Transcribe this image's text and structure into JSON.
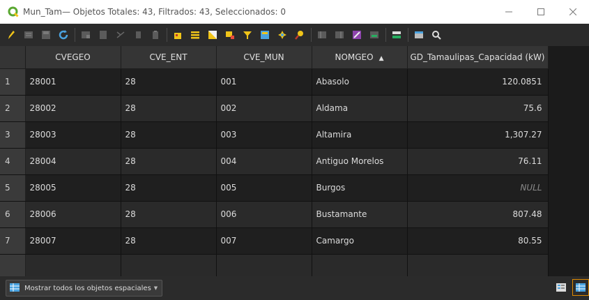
{
  "window": {
    "title": "Mun_Tam— Objetos Totales: 43, Filtrados: 43, Seleccionados: 0"
  },
  "colors": {
    "qgis_green": "#5aa832",
    "highlight_orange": "#e08a00"
  },
  "toolbar": {
    "icons": [
      "pencil-icon",
      "multi-edit-icon",
      "save-edits-icon",
      "reload-icon",
      "add-feature-icon",
      "delete-feature-icon",
      "cut-icon",
      "copy-icon",
      "paste-icon",
      "expression-select-icon",
      "select-all-icon",
      "invert-selection-icon",
      "deselect-all-icon",
      "filter-icon",
      "move-selection-top-icon",
      "pan-to-selection-icon",
      "zoom-to-selection-icon",
      "new-field-icon",
      "delete-field-icon",
      "field-calculator-icon",
      "conditional-format-icon",
      "dock-icon",
      "actions-icon",
      "zoom-icon"
    ]
  },
  "table": {
    "columns": [
      "CVEGEO",
      "CVE_ENT",
      "CVE_MUN",
      "NOMGEO",
      "GD_Tamaulipas_Capacidad (kW)"
    ],
    "sort_indicator": "▲",
    "rows": [
      {
        "n": "1",
        "cvegeo": "28001",
        "cve_ent": "28",
        "cve_mun": "001",
        "nomgeo": "Abasolo",
        "cap": "120.0851"
      },
      {
        "n": "2",
        "cvegeo": "28002",
        "cve_ent": "28",
        "cve_mun": "002",
        "nomgeo": "Aldama",
        "cap": "75.6"
      },
      {
        "n": "3",
        "cvegeo": "28003",
        "cve_ent": "28",
        "cve_mun": "003",
        "nomgeo": "Altamira",
        "cap": "1,307.27"
      },
      {
        "n": "4",
        "cvegeo": "28004",
        "cve_ent": "28",
        "cve_mun": "004",
        "nomgeo": "Antiguo Morelos",
        "cap": "76.11"
      },
      {
        "n": "5",
        "cvegeo": "28005",
        "cve_ent": "28",
        "cve_mun": "005",
        "nomgeo": "Burgos",
        "cap": "NULL"
      },
      {
        "n": "6",
        "cvegeo": "28006",
        "cve_ent": "28",
        "cve_mun": "006",
        "nomgeo": "Bustamante",
        "cap": "807.48"
      },
      {
        "n": "7",
        "cvegeo": "28007",
        "cve_ent": "28",
        "cve_mun": "007",
        "nomgeo": "Camargo",
        "cap": "80.55"
      }
    ]
  },
  "bottom": {
    "filter_label": "Mostrar todos los objetos espaciales"
  }
}
